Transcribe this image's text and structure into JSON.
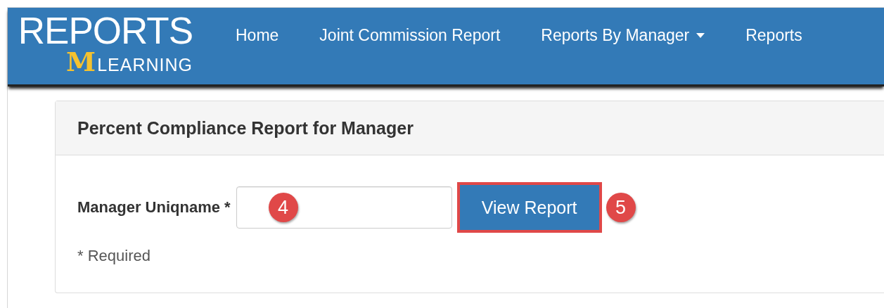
{
  "logo": {
    "title": "REPORTS",
    "mark": "M",
    "subtitle": "LEARNING"
  },
  "nav": [
    {
      "label": "Home",
      "dropdown": false
    },
    {
      "label": "Joint Commission Report",
      "dropdown": false
    },
    {
      "label": "Reports By Manager",
      "dropdown": true
    },
    {
      "label": "Reports",
      "dropdown": false
    }
  ],
  "panel": {
    "title": "Percent Compliance Report for Manager",
    "field": {
      "label": "Manager Uniqname *",
      "callout": "4"
    },
    "button": {
      "label": "View Report",
      "highlighted": true,
      "callout": "5"
    },
    "note": "* Required"
  }
}
